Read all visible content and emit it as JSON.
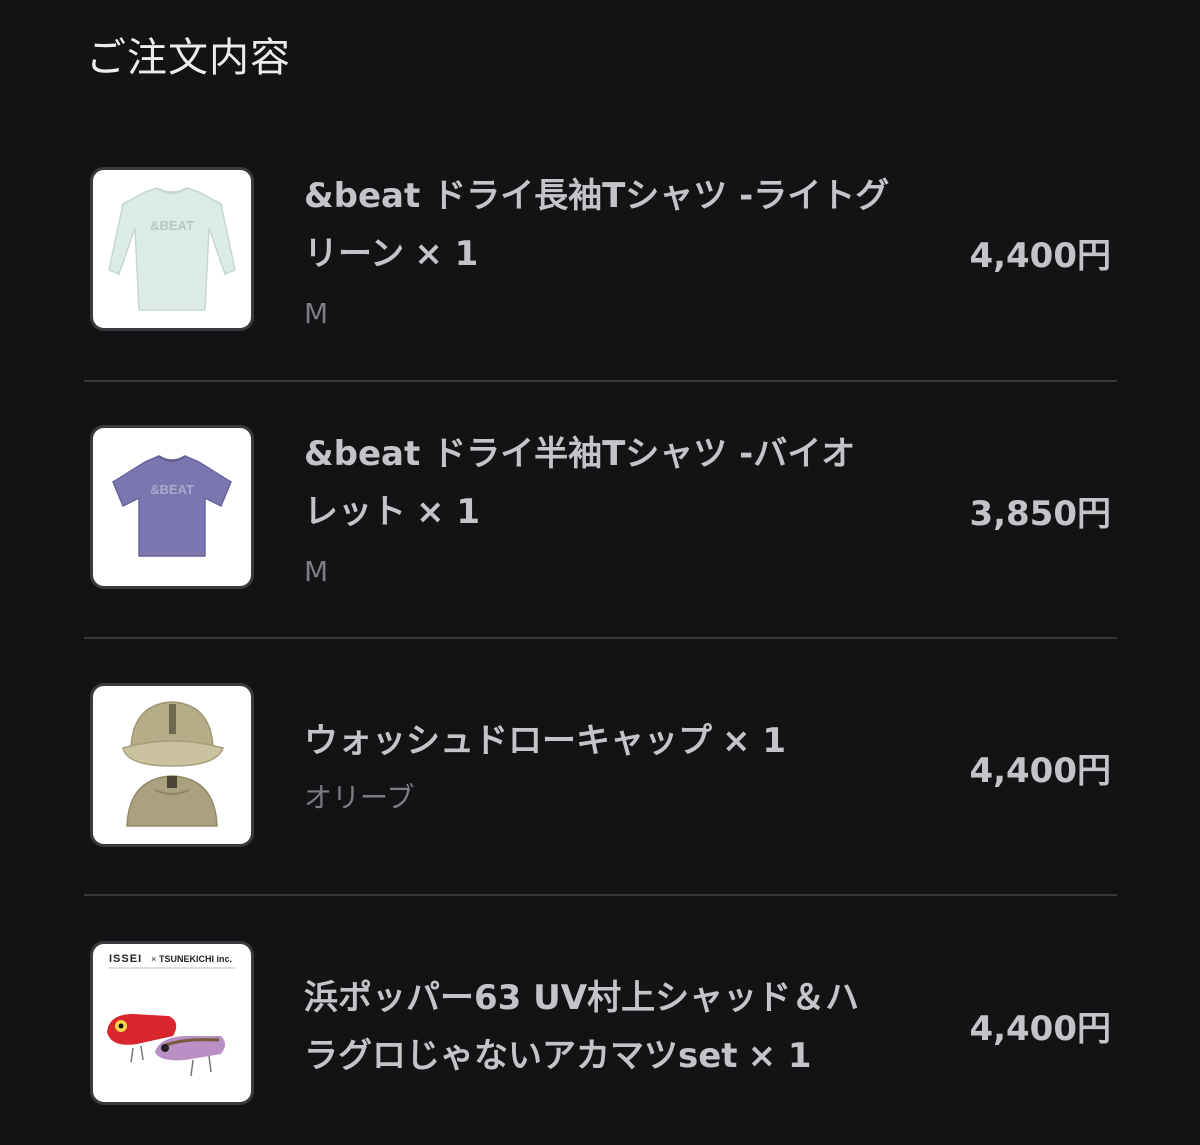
{
  "section": {
    "title": "ご注文内容"
  },
  "items": [
    {
      "name_line1": "&beat ドライ長袖Tシャツ -ライトグ",
      "name_line2": "リーン",
      "quantity": "× 1",
      "variant": "M",
      "price": "4,400円",
      "thumb_print": "&BEAT",
      "thumb_icon": "long-sleeve-shirt-icon",
      "thumb_color": "#dcebe4"
    },
    {
      "name_line1": "&beat ドライ半袖Tシャツ -バイオ",
      "name_line2": "レット",
      "quantity": "× 1",
      "variant": "M",
      "price": "3,850円",
      "thumb_print": "&BEAT",
      "thumb_icon": "short-sleeve-shirt-icon",
      "thumb_color": "#7c76b0"
    },
    {
      "name_line1": "ウォッシュドローキャップ",
      "quantity": "× 1",
      "variant": "オリーブ",
      "price": "4,400円",
      "thumb_icon": "cap-icon",
      "thumb_color": "#b5ad88"
    },
    {
      "name_line1": "浜ポッパー63 UV村上シャッド＆ハ",
      "name_line2": "ラグロじゃないアカマツset",
      "quantity": "× 1",
      "price": "4,400円",
      "thumb_brand_left": "ISSEI",
      "thumb_brand_x": "×",
      "thumb_brand_right": "TSUNEKICHI inc.",
      "thumb_icon": "fishing-lure-icon",
      "thumb_color": "#d9262c"
    }
  ]
}
